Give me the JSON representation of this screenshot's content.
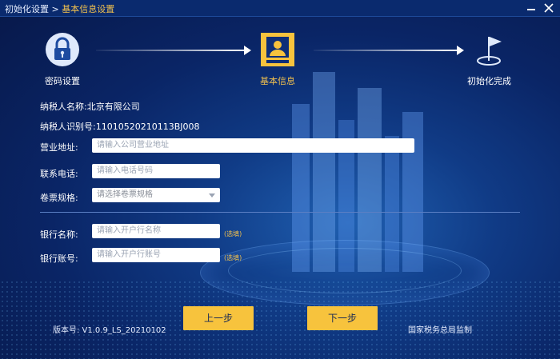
{
  "titlebar": {
    "crumb_root": "初始化设置",
    "crumb_sep": ">",
    "crumb_current": "基本信息设置"
  },
  "steps": [
    {
      "label": "密码设置",
      "icon": "lock-icon"
    },
    {
      "label": "基本信息",
      "icon": "id-card-icon",
      "active": true
    },
    {
      "label": "初始化完成",
      "icon": "flag-icon"
    }
  ],
  "taxpayer": {
    "name_label": "纳税人名称:",
    "name_value": "北京有限公司",
    "id_label": "纳税人识别号:",
    "id_value": "11010520210113BJ008"
  },
  "form": {
    "address": {
      "label": "营业地址:",
      "placeholder": "请输入公司营业地址"
    },
    "phone": {
      "label": "联系电话:",
      "placeholder": "请输入电话号码"
    },
    "spec": {
      "label": "卷票规格:",
      "placeholder": "请选择卷票规格"
    },
    "bank_name": {
      "label": "银行名称:",
      "placeholder": "请输入开户行名称",
      "hint": "(选填)"
    },
    "bank_account": {
      "label": "银行账号:",
      "placeholder": "请输入开户行账号",
      "hint": "(选填)"
    }
  },
  "buttons": {
    "prev": "上一步",
    "next": "下一步"
  },
  "footer": {
    "version": "版本号: V1.0.9_LS_20210102",
    "authority": "国家税务总局监制"
  },
  "colors": {
    "accent": "#f7c33d",
    "background": "#0a2566"
  }
}
